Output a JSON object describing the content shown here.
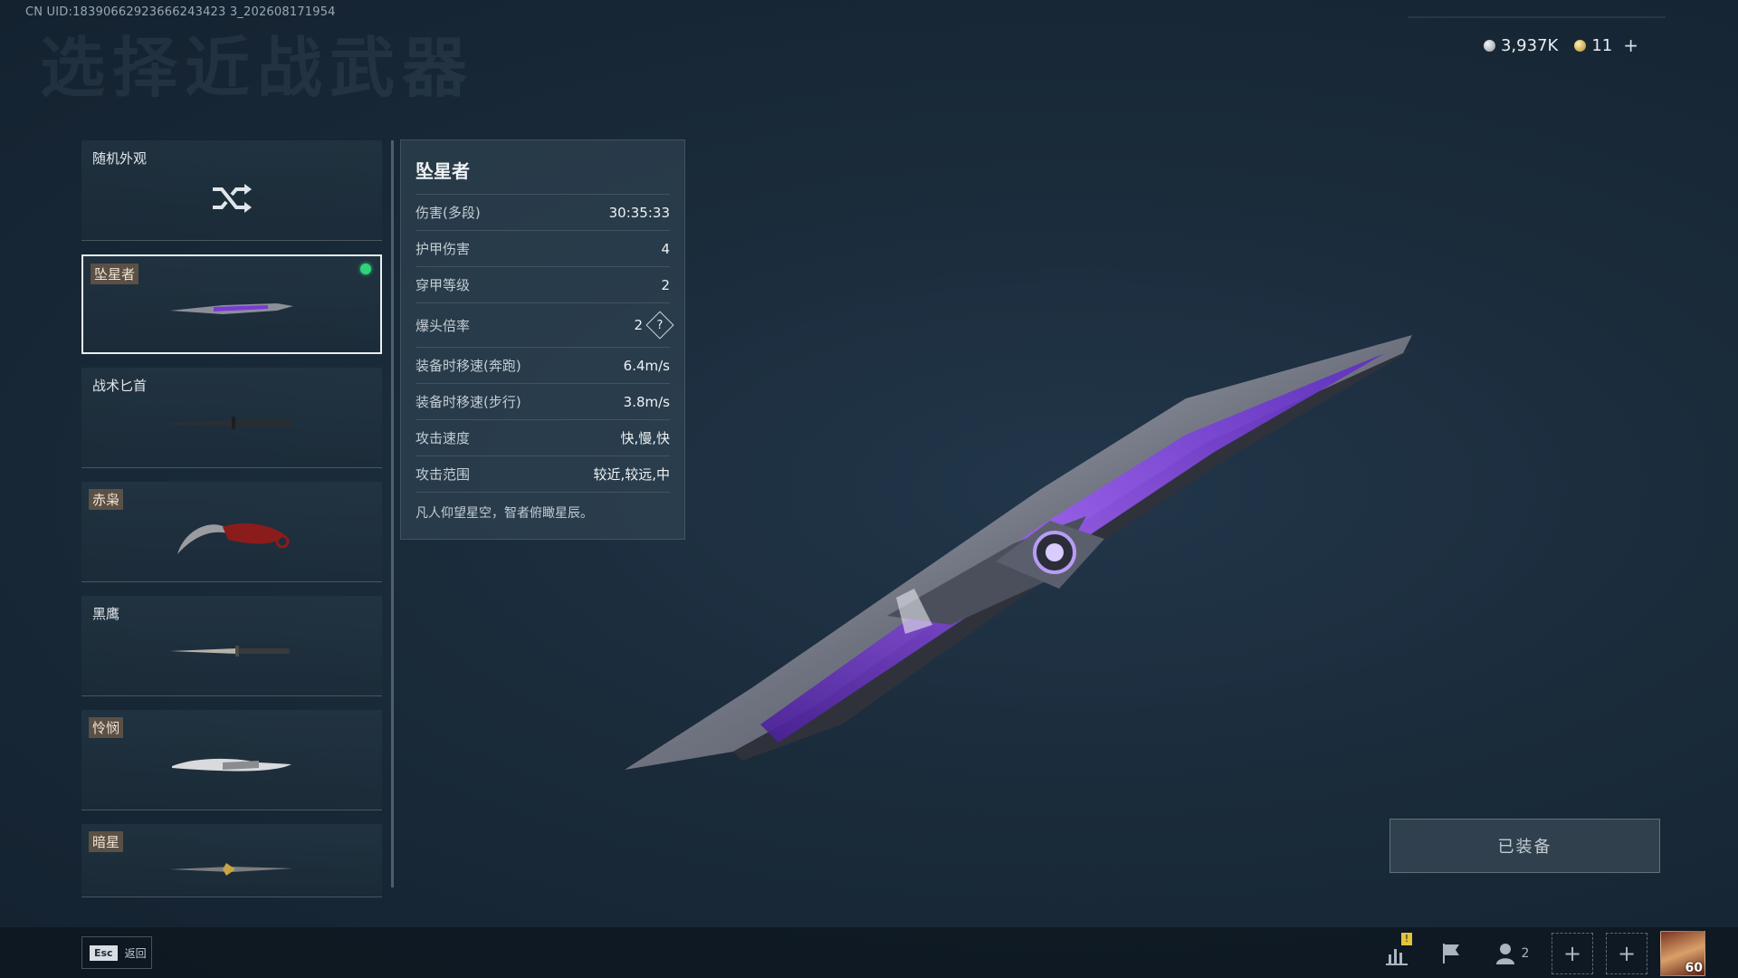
{
  "header": {
    "uid": "CN UID:18390662923666243423 3_202608171954",
    "title_watermark": "选择近战武器"
  },
  "currency": {
    "coins": "3,937K",
    "tokens": "11",
    "add": "+"
  },
  "weapons": [
    {
      "label": "随机外观",
      "icon": "shuffle-icon"
    },
    {
      "label": "坠星者",
      "selected": true,
      "equipped_dot": true
    },
    {
      "label": "战术匕首"
    },
    {
      "label": "赤枭"
    },
    {
      "label": "黑鹰"
    },
    {
      "label": "怜悯"
    },
    {
      "label": "暗星"
    }
  ],
  "stats": {
    "name": "坠星者",
    "rows": [
      {
        "k": "伤害(多段)",
        "v": "30:35:33"
      },
      {
        "k": "护甲伤害",
        "v": "4"
      },
      {
        "k": "穿甲等级",
        "v": "2"
      },
      {
        "k": "爆头倍率",
        "v": "2"
      },
      {
        "k": "装备时移速(奔跑)",
        "v": "6.4m/s"
      },
      {
        "k": "装备时移速(步行)",
        "v": "3.8m/s"
      },
      {
        "k": "攻击速度",
        "v": "快,慢,快"
      },
      {
        "k": "攻击范围",
        "v": "较近,较远,中"
      }
    ],
    "help": "?",
    "description": "凡人仰望星空，智者俯瞰星辰。"
  },
  "equip_button": "已装备",
  "bottom": {
    "esc_key": "Esc",
    "back": "返回",
    "friends_count": "2",
    "warn": "!",
    "add1": "+",
    "add2": "+",
    "level": "60"
  },
  "colors": {
    "equipped_dot": "#2fd37a",
    "tag_bg": "#5b5046",
    "knife_purple": "#7a3bd6"
  }
}
